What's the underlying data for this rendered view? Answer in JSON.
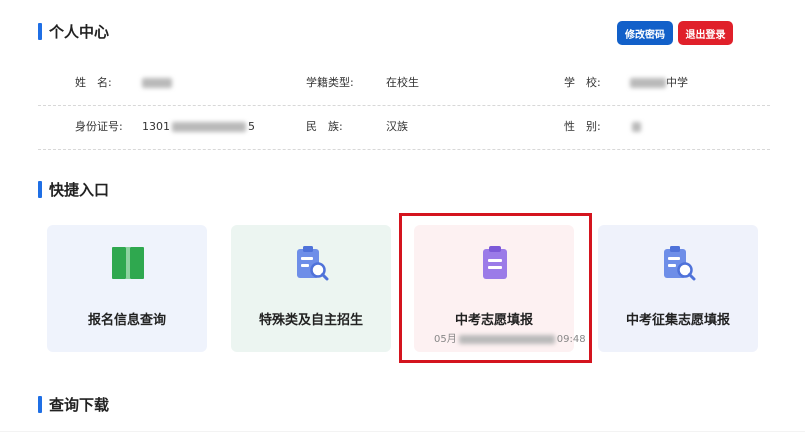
{
  "header": {
    "title": "个人中心",
    "buttons": {
      "change_password": "修改密码",
      "logout": "退出登录"
    }
  },
  "profile": {
    "row1": {
      "name_label": "姓　名:",
      "name_value": "",
      "status_type_label": "学籍类型:",
      "status_type_value": "在校生",
      "school_label": "学　校:",
      "school_value": "中学"
    },
    "row2": {
      "id_label": "身份证号:",
      "id_prefix": "1301",
      "id_suffix": "5",
      "ethnicity_label": "民　族:",
      "ethnicity_value": "汉族",
      "gender_label": "性　别:",
      "gender_value": ""
    }
  },
  "shortcuts": {
    "title": "快捷入口",
    "items": [
      {
        "label": "报名信息查询",
        "icon": "book-icon",
        "bg": "#eff3fc",
        "color": "#2fa84f"
      },
      {
        "label": "特殊类及自主招生",
        "icon": "document-search-icon",
        "bg": "#ecf5f1",
        "color": "#6e8ee8"
      },
      {
        "label": "中考志愿填报",
        "icon": "clipboard-icon",
        "bg": "#fdf1f2",
        "color": "#9b7be8",
        "timestamp_start": "05月",
        "timestamp_end": "09:48"
      },
      {
        "label": "中考征集志愿填报",
        "icon": "document-search-icon",
        "bg": "#eff2fb",
        "color": "#6e8ee8"
      }
    ]
  },
  "downloads": {
    "title": "查询下载"
  },
  "colors": {
    "accent": "#1f6fe5",
    "primary_button": "#1260c9",
    "danger_button": "#e0202a",
    "highlight_border": "#d4141e"
  }
}
